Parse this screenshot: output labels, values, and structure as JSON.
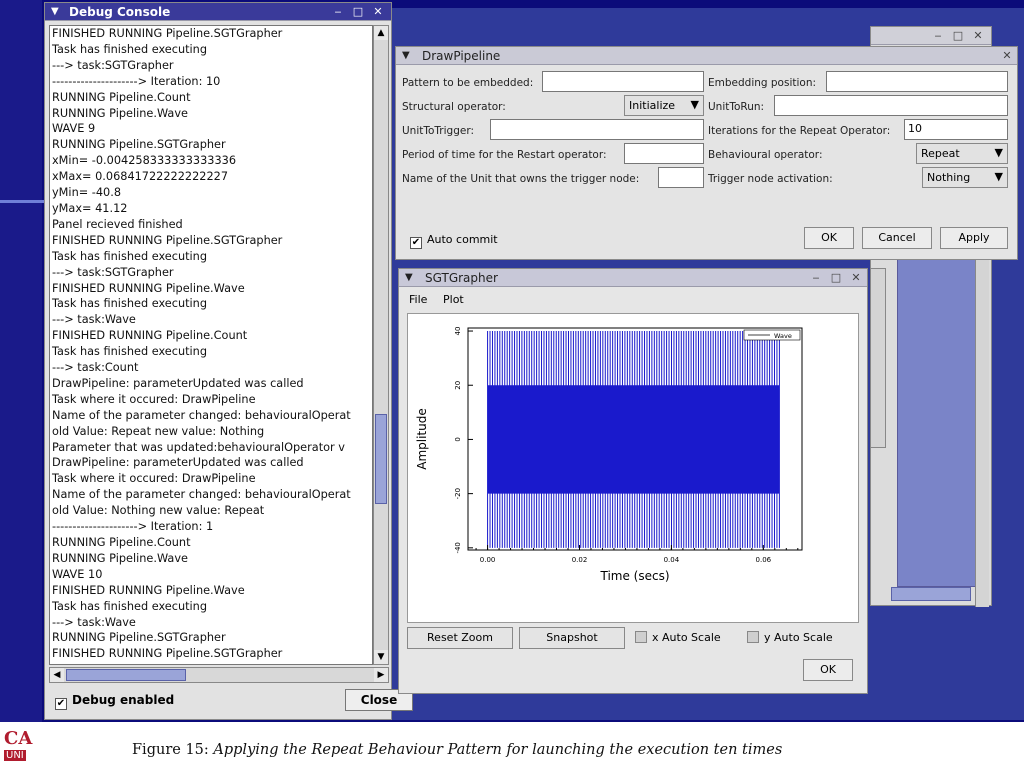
{
  "caption": {
    "label": "Figure 15:",
    "text": "Applying the Repeat Behaviour Pattern for launching the execution ten times"
  },
  "logo": {
    "line1": "CA",
    "line2": "UNI"
  },
  "debug_console": {
    "title": "Debug Console",
    "log_lines": [
      "FINISHED RUNNING Pipeline.SGTGrapher",
      "Task has finished executing",
      "---> task:SGTGrapher",
      "---------------------> Iteration: 10",
      "RUNNING Pipeline.Count",
      "RUNNING Pipeline.Wave",
      "WAVE 9",
      "RUNNING Pipeline.SGTGrapher",
      "xMin= -0.004258333333333336",
      "xMax= 0.06841722222222227",
      "yMin= -40.8",
      "yMax= 41.12",
      "Panel recieved finished",
      "FINISHED RUNNING Pipeline.SGTGrapher",
      "Task has finished executing",
      "---> task:SGTGrapher",
      "FINISHED RUNNING Pipeline.Wave",
      "Task has finished executing",
      "---> task:Wave",
      "FINISHED RUNNING Pipeline.Count",
      "Task has finished executing",
      "---> task:Count",
      "DrawPipeline: parameterUpdated was called",
      "Task where it occured: DrawPipeline",
      "Name of the parameter changed: behaviouralOperat",
      "old Value: Repeat  new value: Nothing",
      "Parameter that was updated:behaviouralOperator  v",
      "DrawPipeline: parameterUpdated was called",
      "Task where it occured: DrawPipeline",
      "Name of the parameter changed: behaviouralOperat",
      "old Value: Nothing  new value: Repeat",
      "---------------------> Iteration: 1",
      "RUNNING Pipeline.Count",
      "RUNNING Pipeline.Wave",
      "WAVE 10",
      "FINISHED RUNNING Pipeline.Wave",
      "Task has finished executing",
      "---> task:Wave",
      "RUNNING Pipeline.SGTGrapher",
      "FINISHED RUNNING Pipeline.SGTGrapher"
    ],
    "debug_enabled_label": "Debug enabled",
    "close_label": "Close"
  },
  "draw_pipeline": {
    "title": "DrawPipeline",
    "pattern_label": "Pattern to be embedded:",
    "pattern_value": "",
    "embedding_position_label": "Embedding position:",
    "embedding_position_value": "",
    "structural_operator_label": "Structural operator:",
    "structural_operator_value": "Initialize",
    "unit_to_run_label": "UnitToRun:",
    "unit_to_run_value": "",
    "unit_to_trigger_label": "UnitToTrigger:",
    "unit_to_trigger_value": "",
    "iterations_label": "Iterations for the Repeat Operator:",
    "iterations_value": "10",
    "period_label": "Period of time for the Restart operator:",
    "period_value": "",
    "behavioural_operator_label": "Behavioural operator:",
    "behavioural_operator_value": "Repeat",
    "unit_owner_label": "Name of the Unit that owns the trigger node:",
    "unit_owner_value": "",
    "trigger_activation_label": "Trigger node activation:",
    "trigger_activation_value": "Nothing",
    "auto_commit_label": "Auto commit",
    "ok_label": "OK",
    "cancel_label": "Cancel",
    "apply_label": "Apply"
  },
  "sgt_grapher": {
    "title": "SGTGrapher",
    "menu": [
      "File",
      "Plot"
    ],
    "reset_zoom_label": "Reset Zoom",
    "snapshot_label": "Snapshot",
    "x_auto_scale_label": "x Auto Scale",
    "y_auto_scale_label": "y Auto Scale",
    "ok_label": "OK"
  },
  "chart_data": {
    "type": "line",
    "title": "",
    "xlabel": "Time (secs)",
    "ylabel": "Amplitude",
    "x_ticks": [
      "0.00",
      "0.02",
      "0.04",
      "0.06"
    ],
    "y_ticks": [
      "40",
      "20",
      "0",
      "-20",
      "-40"
    ],
    "xlim": [
      -0.004258333333333336,
      0.06841722222222227
    ],
    "ylim": [
      -40.8,
      41.12
    ],
    "series": [
      {
        "name": "Wave",
        "color": "#1a1acc",
        "envelope_outer": [
          -40,
          40
        ],
        "envelope_inner": [
          -20,
          20
        ]
      }
    ],
    "legend": "top-right",
    "grid": false
  },
  "colors": {
    "slide_blue": "#1a1a8a",
    "wave_blue": "#1a1acc",
    "titlebar_active": "#3a3a9a"
  }
}
